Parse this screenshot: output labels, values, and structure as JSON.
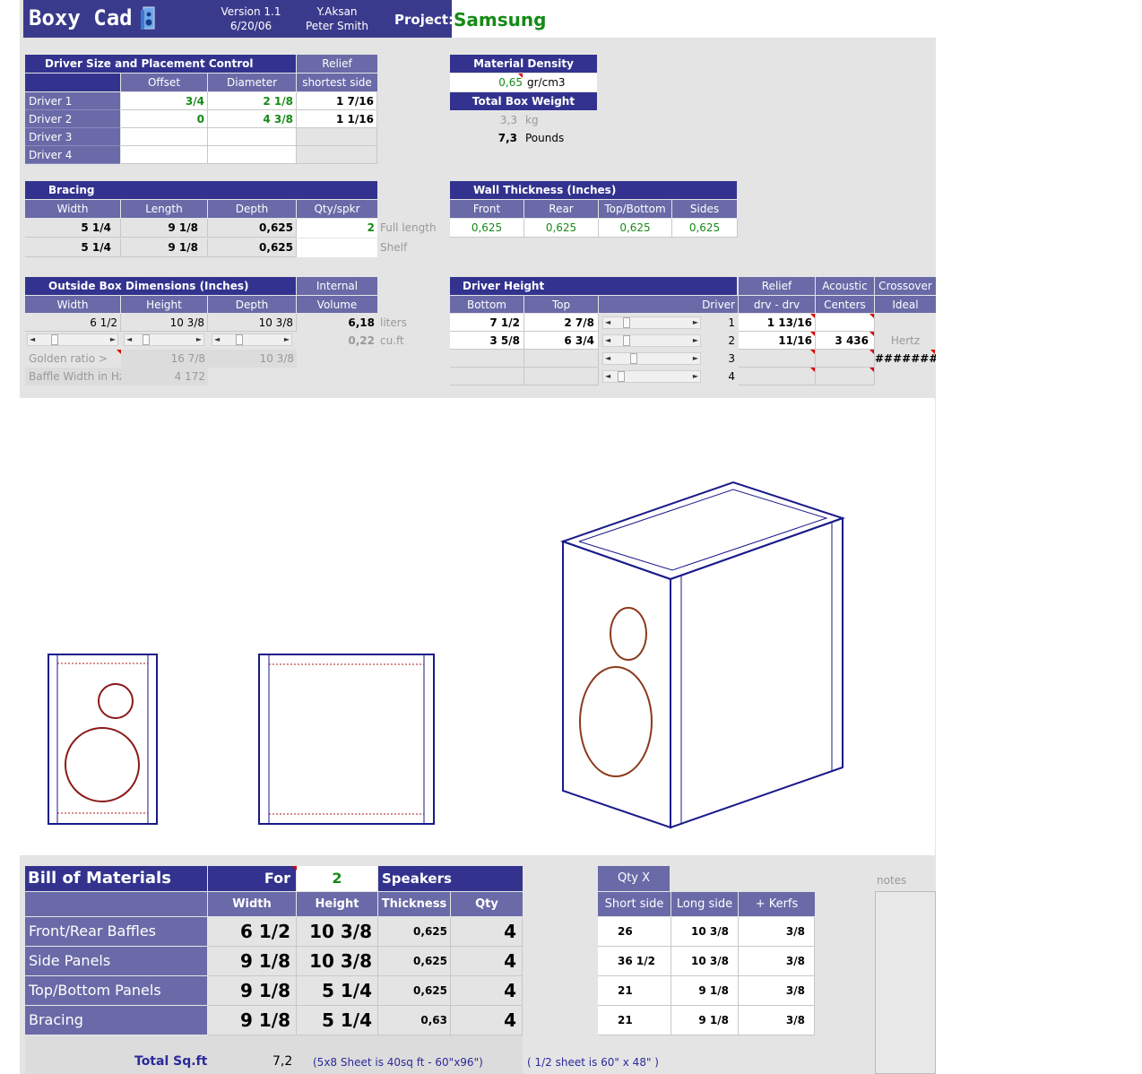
{
  "header": {
    "app_title": "Boxy Cad",
    "version": "Version 1.1",
    "date": "6/20/06",
    "author1": "Y.Aksan",
    "author2": "Peter Smith",
    "project_label": "Project:",
    "project_name": "Samsung"
  },
  "driver_size": {
    "title": "Driver Size and Placement Control",
    "relief_header": "Relief",
    "col_offset": "Offset",
    "col_diameter": "Diameter",
    "col_shortest": "shortest side",
    "rows": [
      {
        "label": "Driver 1",
        "offset": "3/4",
        "diameter": "2 1/8",
        "relief": "1  7/16"
      },
      {
        "label": "Driver 2",
        "offset": "0",
        "diameter": "4 3/8",
        "relief": "1  1/16"
      },
      {
        "label": "Driver 3",
        "offset": "",
        "diameter": "",
        "relief": ""
      },
      {
        "label": "Driver 4",
        "offset": "",
        "diameter": "",
        "relief": ""
      }
    ]
  },
  "material": {
    "density_title": "Material Density",
    "density_value": "0,65",
    "density_unit": "gr/cm3",
    "weight_title": "Total Box Weight",
    "weight_kg": "3,3",
    "weight_kg_unit": "kg",
    "weight_lb": "7,3",
    "weight_lb_unit": "Pounds"
  },
  "bracing": {
    "title": "Bracing",
    "cols": [
      "Width",
      "Length",
      "Depth",
      "Qty/spkr"
    ],
    "rows": [
      {
        "width": "5  1/4",
        "length": "9  1/8",
        "depth": "0,625",
        "qty": "2",
        "note": "Full length"
      },
      {
        "width": "5  1/4",
        "length": "9  1/8",
        "depth": "0,625",
        "qty": "",
        "note": "Shelf"
      }
    ]
  },
  "wall": {
    "title": "Wall Thickness (Inches)",
    "cols": [
      "Front",
      "Rear",
      "Top/Bottom",
      "Sides"
    ],
    "values": [
      "0,625",
      "0,625",
      "0,625",
      "0,625"
    ]
  },
  "outside": {
    "title": "Outside Box Dimensions (Inches)",
    "internal_label": "Internal",
    "volume_label": "Volume",
    "cols": [
      "Width",
      "Height",
      "Depth"
    ],
    "values": [
      "6 1/2",
      "10 3/8",
      "10 3/8"
    ],
    "liters": "6,18",
    "liters_unit": "liters",
    "cuft": "0,22",
    "cuft_unit": "cu.ft",
    "golden_label": "Golden ratio >",
    "golden_height": "16 7/8",
    "golden_depth": "10 3/8",
    "baffle_label": "Baffle Width in Hz",
    "baffle_value": "4 172"
  },
  "driver_height": {
    "title": "Driver Height",
    "col_bottom": "Bottom",
    "col_top": "Top",
    "col_driver": "Driver",
    "relief_label": "Relief",
    "relief_sub": "drv - drv",
    "acoustic_label": "Acoustic",
    "acoustic_sub": "Centers",
    "crossover_label": "Crossover",
    "crossover_sub": "Ideal",
    "hertz": "Hertz",
    "hash": "########",
    "rows": [
      {
        "bottom": "7 1/2",
        "top": "2 7/8",
        "driver": "1",
        "relief": "1 13/16",
        "acoustic": ""
      },
      {
        "bottom": "3 5/8",
        "top": "6 3/4",
        "driver": "2",
        "relief": "11/16",
        "acoustic": "3 436"
      },
      {
        "bottom": "",
        "top": "",
        "driver": "3",
        "relief": "",
        "acoustic": ""
      },
      {
        "bottom": "",
        "top": "",
        "driver": "4",
        "relief": "",
        "acoustic": ""
      }
    ]
  },
  "bom": {
    "title": "Bill of Materials",
    "for_label": "For",
    "count": "2",
    "speakers_label": "Speakers",
    "cols": [
      "Width",
      "Height",
      "Thickness",
      "Qty"
    ],
    "rows": [
      {
        "label": "Front/Rear Baffles",
        "width": "6 1/2",
        "height": "10 3/8",
        "thickness": "0,625",
        "qty": "4"
      },
      {
        "label": "Side Panels",
        "width": "9 1/8",
        "height": "10 3/8",
        "thickness": "0,625",
        "qty": "4"
      },
      {
        "label": "Top/Bottom Panels",
        "width": "9 1/8",
        "height": "5 1/4",
        "thickness": "0,625",
        "qty": "4"
      },
      {
        "label": "Bracing",
        "width": "9 1/8",
        "height": "5 1/4",
        "thickness": "0,63",
        "qty": "4"
      }
    ],
    "total_label": "Total Sq.ft",
    "total_value": "7,2",
    "sheet_note": "(5x8 Sheet is 40sq ft - 60\"x96\")",
    "half_note": "( 1/2 sheet is 60\" x 48\" )"
  },
  "cuts": {
    "qty_label": "Qty  X",
    "cols": [
      "Short side",
      "Long side",
      "+ Kerfs"
    ],
    "rows": [
      {
        "short": "26",
        "long": "10  3/8",
        "kerf": "3/8"
      },
      {
        "short": "36  1/2",
        "long": "10  3/8",
        "kerf": "3/8"
      },
      {
        "short": "21",
        "long": "9  1/8",
        "kerf": "3/8"
      },
      {
        "short": "21",
        "long": "9  1/8",
        "kerf": "3/8"
      }
    ]
  },
  "notes_label": "notes",
  "colors": {
    "header_navy": "#33338f",
    "header_lavender": "#6a6aa8",
    "value_green": "#168a16",
    "drawing_box": "#1a1a8a",
    "drawing_driver": "#8b1a1a"
  }
}
